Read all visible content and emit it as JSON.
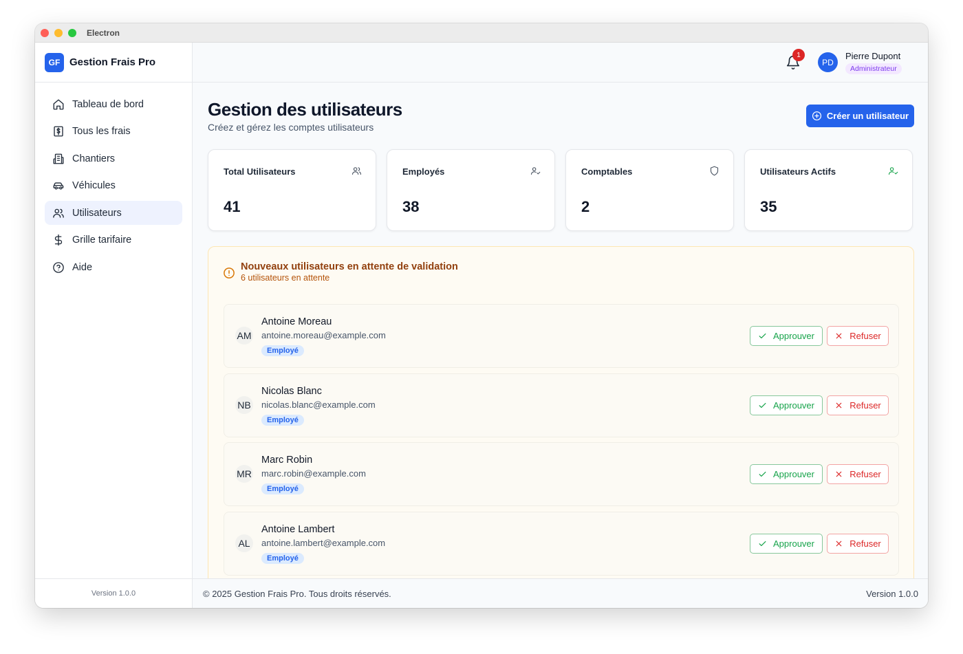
{
  "window": {
    "title": "Electron"
  },
  "brand": {
    "logo": "GF",
    "name": "Gestion Frais Pro"
  },
  "sidebar": {
    "items": [
      {
        "label": "Tableau de bord",
        "icon": "home-icon"
      },
      {
        "label": "Tous les frais",
        "icon": "receipt-dollar-icon"
      },
      {
        "label": "Chantiers",
        "icon": "building-icon"
      },
      {
        "label": "Véhicules",
        "icon": "car-icon"
      },
      {
        "label": "Utilisateurs",
        "icon": "users-icon",
        "active": true
      },
      {
        "label": "Grille tarifaire",
        "icon": "dollar-icon"
      },
      {
        "label": "Aide",
        "icon": "help-circle-icon"
      }
    ],
    "version": "Version 1.0.0"
  },
  "header": {
    "notification_count": "1",
    "user": {
      "initials": "PD",
      "name": "Pierre Dupont",
      "role": "Administrateur"
    }
  },
  "page": {
    "title": "Gestion des utilisateurs",
    "subtitle": "Créez et gérez les comptes utilisateurs",
    "create_button": "Créer un utilisateur"
  },
  "stats": [
    {
      "label": "Total Utilisateurs",
      "value": "41",
      "icon": "users-icon"
    },
    {
      "label": "Employés",
      "value": "38",
      "icon": "user-check-icon"
    },
    {
      "label": "Comptables",
      "value": "2",
      "icon": "shield-icon"
    },
    {
      "label": "Utilisateurs Actifs",
      "value": "35",
      "icon": "user-check-icon"
    }
  ],
  "pending": {
    "title": "Nouveaux utilisateurs en attente de validation",
    "subtitle": "6 utilisateurs en attente",
    "approve_label": "Approuver",
    "refuse_label": "Refuser",
    "users": [
      {
        "initials": "AM",
        "name": "Antoine Moreau",
        "email": "antoine.moreau@example.com",
        "role": "Employé"
      },
      {
        "initials": "NB",
        "name": "Nicolas Blanc",
        "email": "nicolas.blanc@example.com",
        "role": "Employé"
      },
      {
        "initials": "MR",
        "name": "Marc Robin",
        "email": "marc.robin@example.com",
        "role": "Employé"
      },
      {
        "initials": "AL",
        "name": "Antoine Lambert",
        "email": "antoine.lambert@example.com",
        "role": "Employé"
      }
    ]
  },
  "footer": {
    "copyright": "© 2025 Gestion Frais Pro. Tous droits réservés.",
    "version": "Version 1.0.0"
  },
  "colors": {
    "accent": "#2563eb",
    "warning_title": "#92400e",
    "approve": "#16a34a",
    "refuse": "#dc2626"
  }
}
